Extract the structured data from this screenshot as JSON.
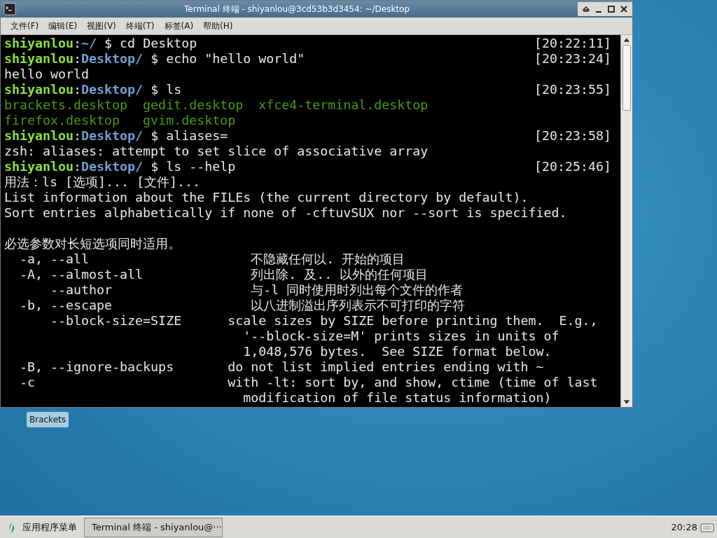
{
  "window": {
    "title": "Terminal 终端 - shiyanlou@3cd53b3d3454: ~/Desktop"
  },
  "menu": [
    "文件(F)",
    "编辑(E)",
    "视图(V)",
    "终端(T)",
    "标签(A)",
    "帮助(H)"
  ],
  "terminal": {
    "lines": [
      {
        "kind": "prompt",
        "user": "shiyanlou",
        "separator": ":",
        "path": "~/",
        "command": "$ cd Desktop",
        "time": "[20:22:11]"
      },
      {
        "kind": "prompt",
        "user": "shiyanlou",
        "separator": ":",
        "path": "Desktop/",
        "command": "$ echo \"hello world\"",
        "time": "[20:23:24]"
      },
      {
        "kind": "output",
        "text": "hello world"
      },
      {
        "kind": "prompt",
        "user": "shiyanlou",
        "separator": ":",
        "path": "Desktop/",
        "command": "$ ls",
        "time": "[20:23:55]"
      },
      {
        "kind": "files",
        "text": "brackets.desktop  gedit.desktop  xfce4-terminal.desktop"
      },
      {
        "kind": "files",
        "text": "firefox.desktop   gvim.desktop"
      },
      {
        "kind": "prompt",
        "user": "shiyanlou",
        "separator": ":",
        "path": "Desktop/",
        "command": "$ aliases=",
        "time": "[20:23:58]"
      },
      {
        "kind": "output",
        "text": "zsh: aliases: attempt to set slice of associative array"
      },
      {
        "kind": "prompt",
        "user": "shiyanlou",
        "separator": ":",
        "path": "Desktop/",
        "command": "$ ls --help",
        "time": "[20:25:46]"
      },
      {
        "kind": "output",
        "text": "用法：ls [选项]... [文件]..."
      },
      {
        "kind": "output",
        "text": "List information about the FILEs (the current directory by default)."
      },
      {
        "kind": "output",
        "text": "Sort entries alphabetically if none of -cftuvSUX nor --sort is specified."
      },
      {
        "kind": "blank"
      },
      {
        "kind": "output",
        "text": "必选参数对长短选项同时适用。"
      },
      {
        "kind": "output",
        "text": "  -a, --all                     不隐藏任何以. 开始的项目"
      },
      {
        "kind": "output",
        "text": "  -A, --almost-all              列出除. 及.. 以外的任何项目"
      },
      {
        "kind": "output",
        "text": "      --author                  与-l 同时使用时列出每个文件的作者"
      },
      {
        "kind": "output",
        "text": "  -b, --escape                  以八进制溢出序列表示不可打印的字符"
      },
      {
        "kind": "output",
        "text": "      --block-size=SIZE      scale sizes by SIZE before printing them.  E.g.,"
      },
      {
        "kind": "output",
        "text": "                               '--block-size=M' prints sizes in units of"
      },
      {
        "kind": "output",
        "text": "                               1,048,576 bytes.  See SIZE format below."
      },
      {
        "kind": "output",
        "text": "  -B, --ignore-backups       do not list implied entries ending with ~"
      },
      {
        "kind": "output",
        "text": "  -c                         with -lt: sort by, and show, ctime (time of last"
      },
      {
        "kind": "output",
        "text": "                               modification of file status information)"
      }
    ]
  },
  "desktop": {
    "icons": [
      "Brackets"
    ]
  },
  "taskbar": {
    "app_menu": "应用程序菜单",
    "tasks": [
      "Terminal 终端 - shiyanlou@···"
    ],
    "clock": "20:28"
  }
}
